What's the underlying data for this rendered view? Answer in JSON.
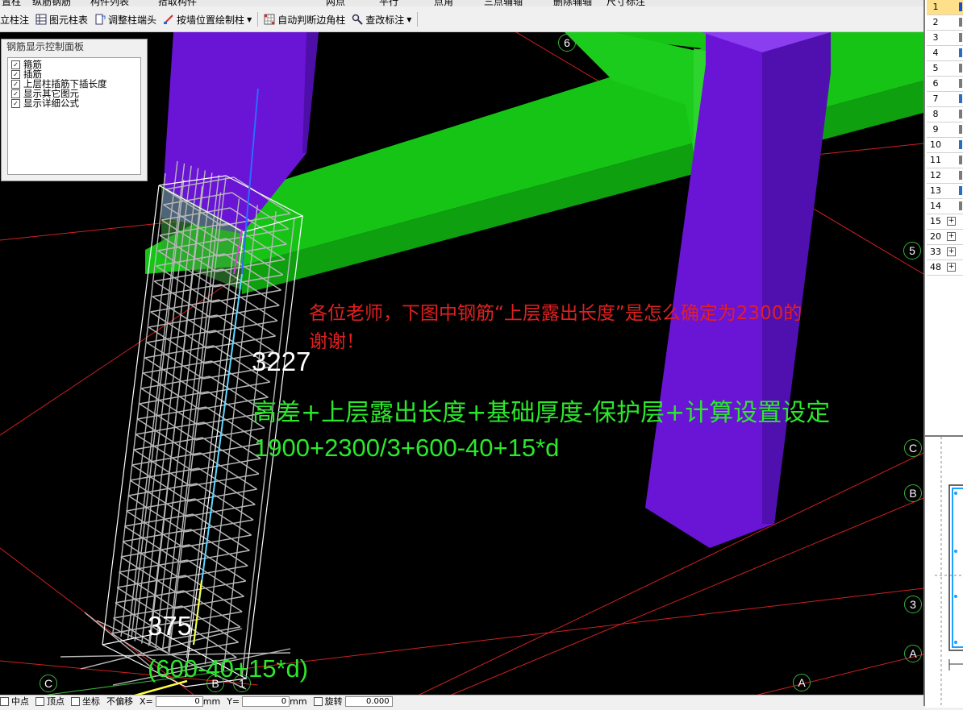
{
  "top_strip": [
    "置柱",
    "纵筋钢筋",
    "构件列表",
    "拾取构件",
    "两点",
    "平行",
    "点角",
    "三点辅轴",
    "删除辅轴",
    "尺寸标注"
  ],
  "toolbar": {
    "items": [
      {
        "label": "立柱注",
        "icon": "column-note-icon"
      },
      {
        "label": "图元柱表",
        "icon": "table-icon"
      },
      {
        "label": "调整柱端头",
        "icon": "adjust-column-end-icon"
      },
      {
        "label": "按墙位置绘制柱",
        "icon": "draw-by-wall-icon",
        "dropdown": true
      },
      {
        "label": "自动判断边角柱",
        "icon": "grid-icon"
      },
      {
        "label": "查改标注",
        "icon": "edit-annotation-icon",
        "dropdown": true
      }
    ]
  },
  "control_panel": {
    "title": "钢筋显示控制面板",
    "options": [
      {
        "label": "箍筋",
        "checked": true
      },
      {
        "label": "插筋",
        "checked": true
      },
      {
        "label": "上层柱插筋下插长度",
        "checked": true
      },
      {
        "label": "显示其它图元",
        "checked": true
      },
      {
        "label": "显示详细公式",
        "checked": true
      }
    ]
  },
  "annotations": {
    "question_line1": "各位老师，下图中钢筋“上层露出长度”是怎么确定为2300的",
    "question_line2": "谢谢！",
    "dim_top": "3227",
    "formula_words": "高差+上层露出长度+基础厚度-保护层+计算设置设定",
    "formula_numbers": "1900+2300/3+600-40+15*d",
    "dim_bottom": "375",
    "formula_bottom": "(600-40+15*d)"
  },
  "axes": {
    "six": "6",
    "five": "5",
    "c_right": "C",
    "b_right": "B",
    "three": "3",
    "a_right": "A",
    "a_bottom": "A",
    "c_left": "C",
    "b_left": "B",
    "one": "1"
  },
  "right_panel": {
    "rows": [
      "1",
      "2",
      "3",
      "4",
      "5",
      "6",
      "7",
      "8",
      "9",
      "10",
      "11",
      "12",
      "13",
      "14",
      "15",
      "20",
      "33",
      "48"
    ],
    "expandable": [
      "15",
      "20",
      "33",
      "48"
    ]
  },
  "status_bar": {
    "items": [
      "中点",
      "顶点",
      "坐标",
      "不偏移"
    ],
    "x_label": "X=",
    "x_value": "0",
    "y_label": "Y=",
    "y_value": "0",
    "unit": "mm",
    "rotate_label": "旋转",
    "rotate_value": "0.000"
  },
  "colors": {
    "viewport_bg": "#000000",
    "beam": "#16c416",
    "column": "#6a14d6",
    "rebar": "#b8b8b8",
    "question_text": "#e02020",
    "formula_text": "#2ce82c",
    "axis_circle": "#39b339",
    "grid_line": "#d02020"
  }
}
